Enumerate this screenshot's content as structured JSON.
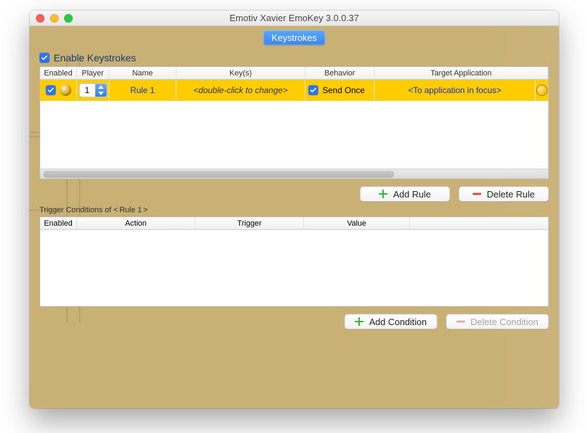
{
  "window": {
    "title": "Emotiv Xavier EmoKey  3.0.0.37"
  },
  "tab": {
    "label": "Keystrokes"
  },
  "enable": {
    "label": "Enable Keystrokes",
    "checked": true
  },
  "rules": {
    "columns": {
      "enabled": "Enabled",
      "player": "Player",
      "name": "Name",
      "keys": "Key(s)",
      "behavior": "Behavior",
      "target": "Target Application"
    },
    "rows": [
      {
        "enabled": true,
        "player": "1",
        "name": "Rule 1",
        "keys": "<double-click to change>",
        "behavior_checked": true,
        "behavior_label": "Send Once",
        "target": "<To application in focus>"
      }
    ]
  },
  "buttons": {
    "add_rule": "Add Rule",
    "delete_rule": "Delete Rule",
    "add_condition": "Add Condition",
    "delete_condition": "Delete Condition"
  },
  "conditions": {
    "title_prefix": "Trigger Conditions of <",
    "title_rule": "Rule 1",
    "title_suffix": ">",
    "columns": {
      "enabled": "Enabled",
      "action": "Action",
      "trigger": "Trigger",
      "value": "Value"
    }
  }
}
